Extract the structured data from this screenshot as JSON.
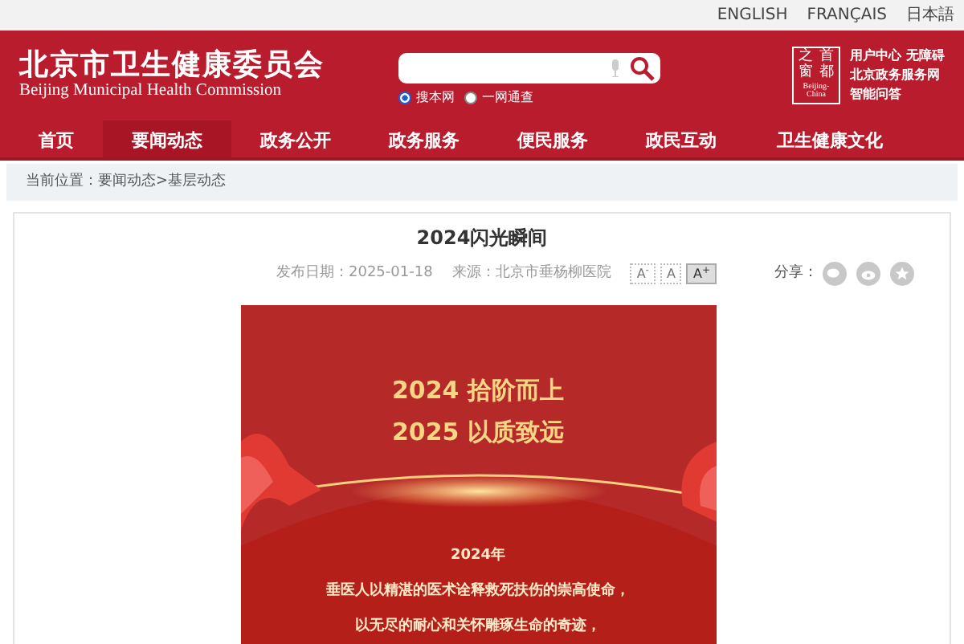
{
  "language_links": [
    "ENGLISH",
    "FRANÇAIS",
    "日本語"
  ],
  "header": {
    "title": "北京市卫生健康委员会",
    "subtitle": "Beijing Municipal Health Commission",
    "search": {
      "options": [
        {
          "label": "搜本网",
          "selected": true
        },
        {
          "label": "一网通查",
          "selected": false
        }
      ]
    },
    "emblem": {
      "chars": [
        "之",
        "首",
        "窗",
        "都"
      ],
      "caption": "Beijing-China"
    },
    "links": [
      [
        "用户中心",
        "无障碍"
      ],
      [
        "北京政务服务网"
      ],
      [
        "智能问答"
      ]
    ]
  },
  "nav": [
    {
      "label": "首页",
      "selected": false
    },
    {
      "label": "要闻动态",
      "selected": true
    },
    {
      "label": "政务公开",
      "selected": false
    },
    {
      "label": "政务服务",
      "selected": false
    },
    {
      "label": "便民服务",
      "selected": false
    },
    {
      "label": "政民互动",
      "selected": false
    },
    {
      "label": "卫生健康文化",
      "selected": false
    }
  ],
  "breadcrumb": {
    "label": "当前位置：",
    "path": "要闻动态>基层动态"
  },
  "article": {
    "title": "2024闪光瞬间",
    "date": "发布日期：2025-01-18",
    "source": "来源：北京市垂杨柳医院",
    "font_sizes": [
      {
        "label": "A$^{-}$",
        "selected": false
      },
      {
        "label": "A",
        "selected": false
      },
      {
        "label": "A$^{+}$",
        "selected": true
      }
    ],
    "share_label": "分享：",
    "poster": {
      "headline": [
        "2024 拾阶而上",
        "2025 以质致远"
      ],
      "lines": [
        "2024年",
        "垂医人以精湛的医术诠释救死扶伤的崇高使命，",
        "以无尽的耐心和关怀雕琢生命的奇迹，"
      ]
    }
  }
}
